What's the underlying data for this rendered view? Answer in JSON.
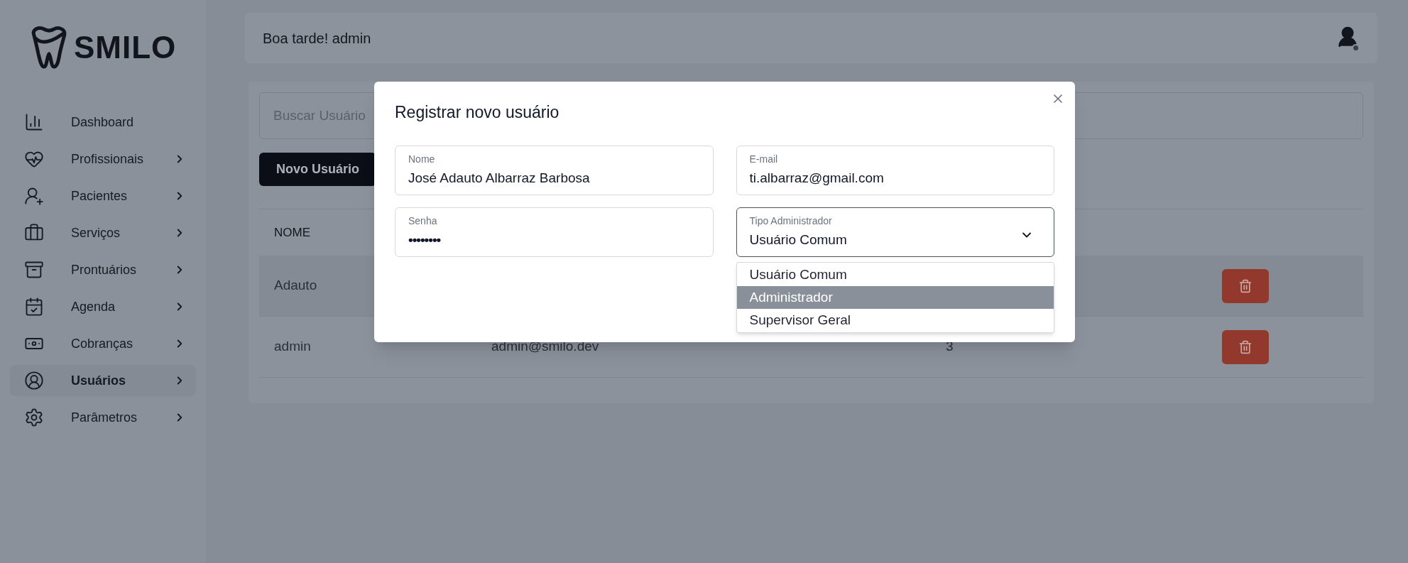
{
  "brand": {
    "name": "SMILO"
  },
  "sidebar": {
    "items": [
      {
        "label": "Dashboard",
        "has_submenu": false,
        "selected": false
      },
      {
        "label": "Profissionais",
        "has_submenu": true,
        "selected": false
      },
      {
        "label": "Pacientes",
        "has_submenu": true,
        "selected": false
      },
      {
        "label": "Serviços",
        "has_submenu": true,
        "selected": false
      },
      {
        "label": "Prontuários",
        "has_submenu": true,
        "selected": false
      },
      {
        "label": "Agenda",
        "has_submenu": true,
        "selected": false
      },
      {
        "label": "Cobranças",
        "has_submenu": true,
        "selected": false
      },
      {
        "label": "Usuários",
        "has_submenu": true,
        "selected": true
      },
      {
        "label": "Parâmetros",
        "has_submenu": true,
        "selected": false
      }
    ]
  },
  "header": {
    "greeting": "Boa tarde! admin"
  },
  "users": {
    "search": {
      "placeholder": "Buscar Usuário"
    },
    "new_button": "Novo Usuário",
    "table": {
      "columns": [
        "NOME"
      ],
      "rows": [
        {
          "cells": [
            "Adauto"
          ],
          "selected": true
        },
        {
          "cells": [
            "admin",
            "admin@smilo.dev",
            "3"
          ],
          "selected": false
        }
      ]
    }
  },
  "modal": {
    "title": "Registrar novo usuário",
    "fields": [
      {
        "kind": "text",
        "label": "Nome",
        "value": "José Adauto Albarraz Barbosa"
      },
      {
        "kind": "text",
        "label": "E-mail",
        "value": "ti.albarraz@gmail.com"
      },
      {
        "kind": "password",
        "label": "Senha",
        "value": "••••••••"
      },
      {
        "kind": "select",
        "label": "Tipo Administrador",
        "value": "Usuário Comum",
        "expanded": true,
        "options": [
          {
            "label": "Usuário Comum",
            "highlighted": false
          },
          {
            "label": "Administrador",
            "highlighted": true
          },
          {
            "label": "Supervisor Geral",
            "highlighted": false
          }
        ]
      }
    ]
  }
}
